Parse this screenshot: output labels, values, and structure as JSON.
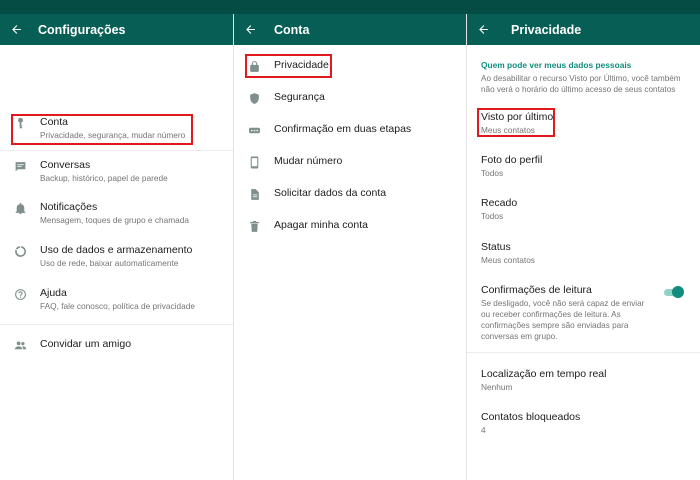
{
  "colors": {
    "appbar": "#075e54",
    "statusbar": "#054d44",
    "accent": "#128c7e",
    "highlight": "#e0191f"
  },
  "panel1": {
    "title": "Configurações",
    "items": [
      {
        "icon": "key-icon",
        "label": "Conta",
        "sub": "Privacidade, segurança, mudar número"
      },
      {
        "icon": "chat-icon",
        "label": "Conversas",
        "sub": "Backup, histórico, papel de parede"
      },
      {
        "icon": "bell-icon",
        "label": "Notificações",
        "sub": "Mensagem, toques de grupo e chamada"
      },
      {
        "icon": "data-usage-icon",
        "label": "Uso de dados e armazenamento",
        "sub": "Uso de rede, baixar automaticamente"
      },
      {
        "icon": "help-icon",
        "label": "Ajuda",
        "sub": "FAQ, fale conosco, política de privacidade"
      },
      {
        "icon": "people-icon",
        "label": "Convidar um amigo"
      }
    ]
  },
  "panel2": {
    "title": "Conta",
    "items": [
      {
        "icon": "lock-icon",
        "label": "Privacidade"
      },
      {
        "icon": "shield-icon",
        "label": "Segurança"
      },
      {
        "icon": "dots-icon",
        "label": "Confirmação em duas etapas"
      },
      {
        "icon": "phone-swap-icon",
        "label": "Mudar número"
      },
      {
        "icon": "document-icon",
        "label": "Solicitar dados da conta"
      },
      {
        "icon": "trash-icon",
        "label": "Apagar minha conta"
      }
    ]
  },
  "panel3": {
    "title": "Privacidade",
    "section_header": "Quem pode ver meus dados pessoais",
    "section_desc": "Ao desabilitar o recurso Visto por Último, você também não verá o horário do último acesso de seus contatos",
    "items": [
      {
        "label": "Visto por último",
        "value": "Meus contatos"
      },
      {
        "label": "Foto do perfil",
        "value": "Todos"
      },
      {
        "label": "Recado",
        "value": "Todos"
      },
      {
        "label": "Status",
        "value": "Meus contatos"
      },
      {
        "label": "Confirmações de leitura",
        "value": "Se desligado, você não será capaz de enviar ou receber confirmações de leitura. As confirmações sempre são enviadas para conversas em grupo.",
        "toggle_on": true
      },
      {
        "label": "Localização em tempo real",
        "value": "Nenhum"
      },
      {
        "label": "Contatos bloqueados",
        "value": "4"
      }
    ]
  }
}
